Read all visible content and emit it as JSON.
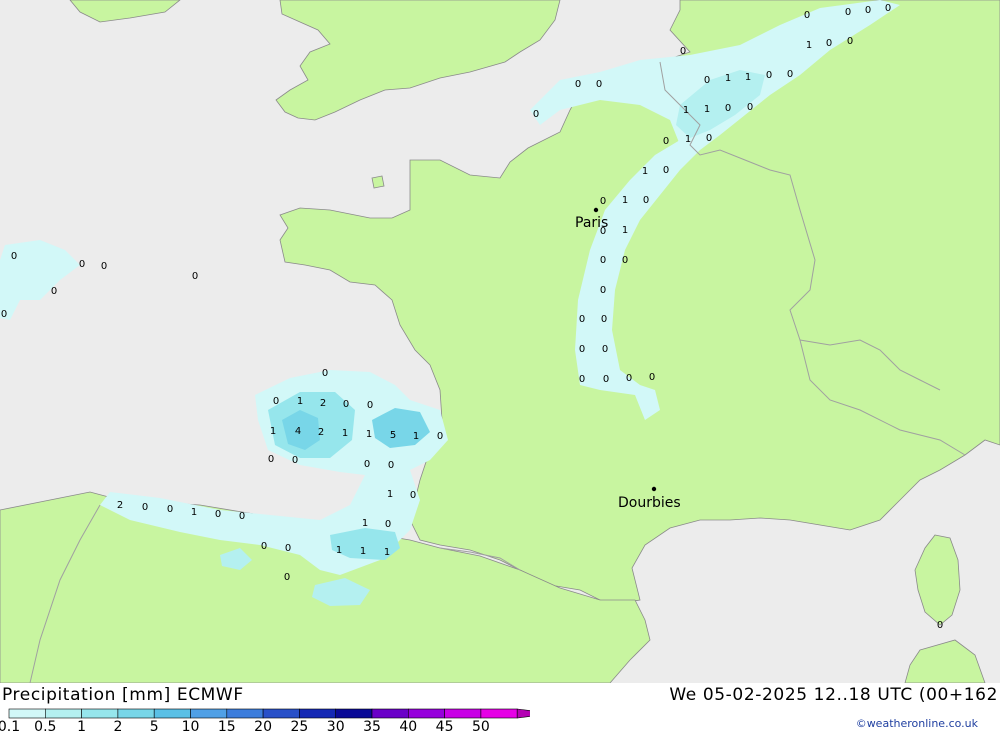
{
  "title": "Precipitation [mm] ECMWF",
  "datetime": "We 05-02-2025 12..18 UTC (00+162",
  "credit": "©weatheronline.co.uk",
  "colors": {
    "sea": "#ececec",
    "land": "#c8f5a0",
    "border": "#a0a0a0",
    "coast": "#8a8a8a"
  },
  "cities": [
    {
      "name": "Paris"
    },
    {
      "name": "Dourbies"
    }
  ],
  "legend": {
    "labels": [
      "0.1",
      "0.5",
      "1",
      "2",
      "5",
      "10",
      "15",
      "20",
      "25",
      "30",
      "35",
      "40",
      "45",
      "50"
    ],
    "colors": [
      "#d2f8f8",
      "#b4f0f0",
      "#96e6ec",
      "#78d6e8",
      "#5ac0e6",
      "#50a0e6",
      "#3c7ddc",
      "#2850c8",
      "#1428b4",
      "#0a0a96",
      "#6a00c8",
      "#9600dc",
      "#c800e6",
      "#e600e6",
      "#b400b4"
    ]
  },
  "precip_values": [
    "0",
    "0",
    "0",
    "0",
    "1",
    "0",
    "0",
    "0",
    "1",
    "1",
    "0",
    "0",
    "1",
    "1",
    "0",
    "0",
    "0",
    "1",
    "0",
    "1",
    "0",
    "0",
    "1",
    "0",
    "0",
    "1",
    "0",
    "0",
    "0",
    "0",
    "0",
    "0",
    "0",
    "0",
    "0",
    "0",
    "0",
    "0",
    "0",
    "0",
    "0",
    "0",
    "0",
    "0",
    "0",
    "0",
    "0",
    "0",
    "1",
    "2",
    "0",
    "0",
    "1",
    "4",
    "2",
    "1",
    "1",
    "5",
    "1",
    "0",
    "0",
    "0",
    "0",
    "0",
    "1",
    "0",
    "1",
    "0",
    "2",
    "0",
    "0",
    "1",
    "0",
    "0",
    "0",
    "0",
    "1",
    "1",
    "1",
    "0",
    "0",
    "0"
  ]
}
